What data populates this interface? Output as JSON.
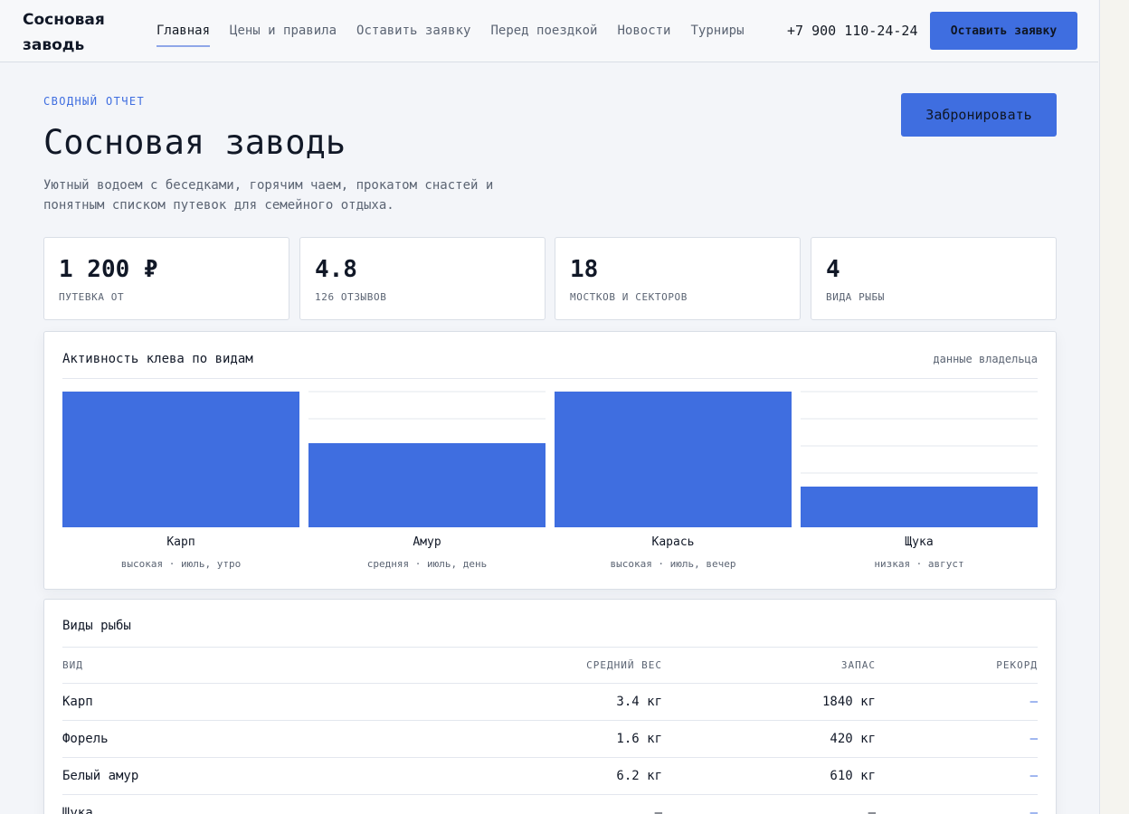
{
  "header": {
    "brand": "Сосновая заводь",
    "nav": [
      "Главная",
      "Цены и правила",
      "Оставить заявку",
      "Перед поездкой",
      "Новости",
      "Турниры"
    ],
    "phone": "+7 900 110-24-24",
    "cta": "Оставить заявку"
  },
  "hero": {
    "eyebrow": "Сводный отчет",
    "title": "Сосновая заводь",
    "description": "Уютный водоем с беседками, горячим чаем, прокатом снастей и понятным списком путевок для семейного отдыха.",
    "book_button": "Забронировать"
  },
  "stats": [
    {
      "value": "1 200 ₽",
      "label": "Путевка от"
    },
    {
      "value": "4.8",
      "label": "126 отзывов"
    },
    {
      "value": "18",
      "label": "Мостков и секторов"
    },
    {
      "value": "4",
      "label": "Вида рыбы"
    }
  ],
  "chart_card": {
    "title": "Активность клева по видам",
    "note": "данные владельца"
  },
  "chart_data": {
    "type": "bar",
    "categories": [
      "Карп",
      "Амур",
      "Карась",
      "Щука"
    ],
    "subtitles": [
      "высокая · июль, утро",
      "средняя · июль, день",
      "высокая · июль, вечер",
      "низкая · август"
    ],
    "values": [
      100,
      62,
      100,
      30
    ],
    "ylim": [
      0,
      100
    ],
    "grid": true,
    "colors": {
      "bar": "#3f6ee0",
      "grid": "#e3e7ee"
    }
  },
  "table_card": {
    "title": "Виды рыбы",
    "columns": [
      "Вид",
      "Средний вес",
      "Запас",
      "Рекорд"
    ],
    "rows": [
      [
        "Карп",
        "3.4 кг",
        "1840 кг",
        "—"
      ],
      [
        "Форель",
        "1.6 кг",
        "420 кг",
        "—"
      ],
      [
        "Белый амур",
        "6.2 кг",
        "610 кг",
        "—"
      ],
      [
        "Щука",
        "—",
        "—",
        "—"
      ]
    ]
  },
  "colors": {
    "accent": "#3f6ee0"
  }
}
